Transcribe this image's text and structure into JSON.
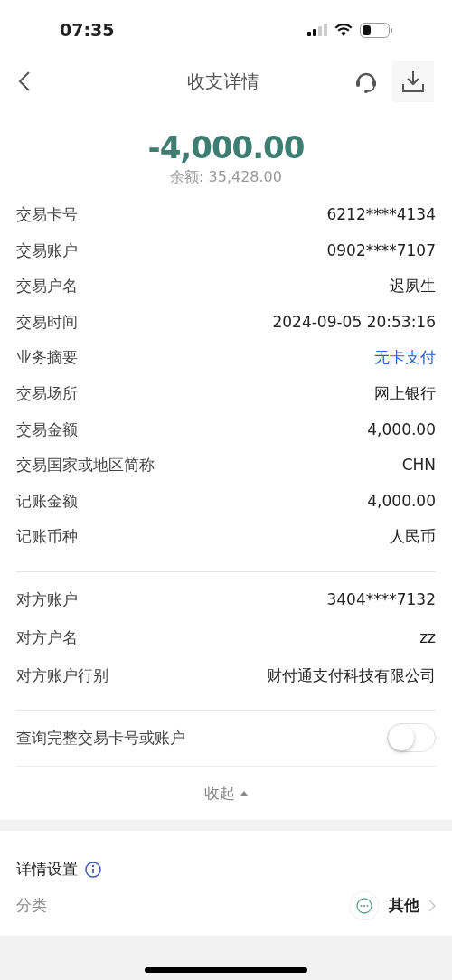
{
  "status_bar": {
    "time": "07:35"
  },
  "nav": {
    "title": "收支详情"
  },
  "summary": {
    "amount": "-4,000.00",
    "balance": "余额: 35,428.00"
  },
  "details": [
    {
      "label": "交易卡号",
      "value": "6212****4134",
      "kind": "text"
    },
    {
      "label": "交易账户",
      "value": "0902****7107",
      "kind": "text"
    },
    {
      "label": "交易户名",
      "value": "迟夙生",
      "kind": "text"
    },
    {
      "label": "交易时间",
      "value": "2024-09-05 20:53:16",
      "kind": "text"
    },
    {
      "label": "业务摘要",
      "value": "无卡支付",
      "kind": "link"
    },
    {
      "label": "交易场所",
      "value": "网上银行",
      "kind": "text"
    },
    {
      "label": "交易金额",
      "value": "4,000.00",
      "kind": "text"
    },
    {
      "label": "交易国家或地区简称",
      "value": "CHN",
      "kind": "text"
    },
    {
      "label": "记账金额",
      "value": "4,000.00",
      "kind": "text"
    },
    {
      "label": "记账币种",
      "value": "人民币",
      "kind": "text"
    }
  ],
  "counterparty": [
    {
      "label": "对方账户",
      "value": "3404****7132"
    },
    {
      "label": "对方户名",
      "value": "zz"
    },
    {
      "label": "对方账户行别",
      "value": "财付通支付科技有限公司"
    }
  ],
  "full_number_toggle": {
    "label": "查询完整交易卡号或账户",
    "on": false
  },
  "collapse": {
    "label": "收起"
  },
  "settings": {
    "title": "详情设置",
    "category_label": "分类",
    "category_value": "其他"
  }
}
